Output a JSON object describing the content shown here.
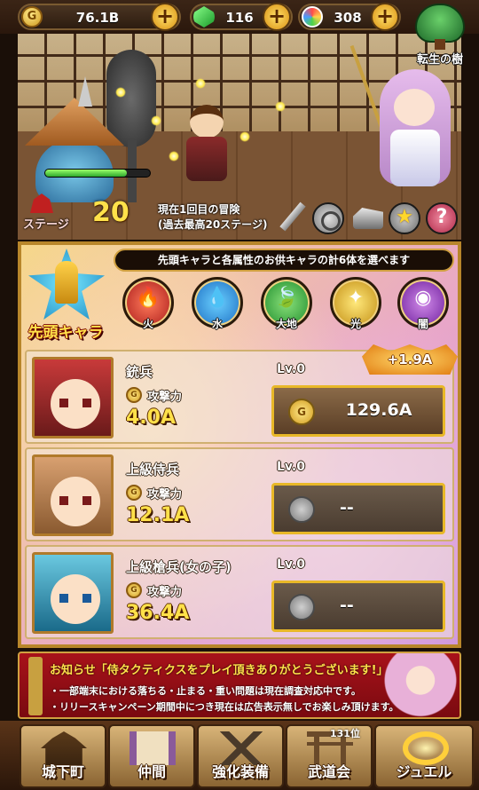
{
  "currency": {
    "gold": {
      "icon": "gold-coin-icon",
      "glyph": "G",
      "value": "76.1B"
    },
    "gems": {
      "icon": "green-gem-icon",
      "value": "116"
    },
    "orbs": {
      "icon": "rainbow-orb-icon",
      "value": "308"
    },
    "plus": "+"
  },
  "reincarnation": {
    "label": "転生の樹"
  },
  "battle": {
    "stage_label": "ステージ",
    "stage_number": "20",
    "run_line1": "現在1回目の冒険",
    "run_line2": "(過去最高20ステージ)",
    "enemy_hp_fraction": 0.78
  },
  "scene_buttons": [
    {
      "name": "weapon-button",
      "icon": "sword-icon"
    },
    {
      "name": "record-button",
      "icon": "disc-icon"
    },
    {
      "name": "armor-button",
      "icon": "armor-icon"
    },
    {
      "name": "favorite-button",
      "icon": "star-icon",
      "glyph": "★"
    },
    {
      "name": "help-button",
      "icon": "question-icon",
      "glyph": "?"
    }
  ],
  "party": {
    "notice": "先頭キャラと各属性のお供キャラの計6体を選べます",
    "lead_label": "先頭キャラ",
    "attributes": [
      {
        "label": "火",
        "icon": "fire-icon",
        "glyph": "🔥"
      },
      {
        "label": "水",
        "icon": "water-drop-icon",
        "glyph": "💧"
      },
      {
        "label": "大地",
        "icon": "leaf-icon",
        "glyph": "🍃"
      },
      {
        "label": "光",
        "icon": "light-star-icon",
        "glyph": "✦"
      },
      {
        "label": "闇",
        "icon": "dark-eye-icon",
        "glyph": "◉"
      }
    ],
    "members": [
      {
        "name": "銃兵",
        "level": "Lv.0",
        "attack_label": "攻撃力",
        "attack": "4.0A",
        "cost": "129.6A",
        "bonus": "+1.9A",
        "coin_glyph": "G"
      },
      {
        "name": "上級侍兵",
        "level": "Lv.0",
        "attack_label": "攻撃力",
        "attack": "12.1A",
        "cost": "--",
        "coin_glyph": ""
      },
      {
        "name": "上級槍兵(女の子)",
        "level": "Lv.0",
        "attack_label": "攻撃力",
        "attack": "36.4A",
        "cost": "--",
        "coin_glyph": ""
      }
    ]
  },
  "news": {
    "title": "お知らせ「侍タクティクスをプレイ頂きありがとうございます!」",
    "line1": "・一部端末における落ちる・止まる・重い問題は現在調査対応中です。",
    "line2": "・リリースキャンペーン期間中につき現在は広告表示無しでお楽しみ頂けます。"
  },
  "nav": {
    "items": [
      {
        "label": "城下町",
        "icon": "castle-icon"
      },
      {
        "label": "仲間",
        "icon": "scroll-icon"
      },
      {
        "label": "強化装備",
        "icon": "crossed-swords-icon"
      },
      {
        "label": "武道会",
        "icon": "torii-icon"
      },
      {
        "label": "ジュエル",
        "icon": "jewel-ring-icon"
      }
    ],
    "rank": "131位"
  }
}
